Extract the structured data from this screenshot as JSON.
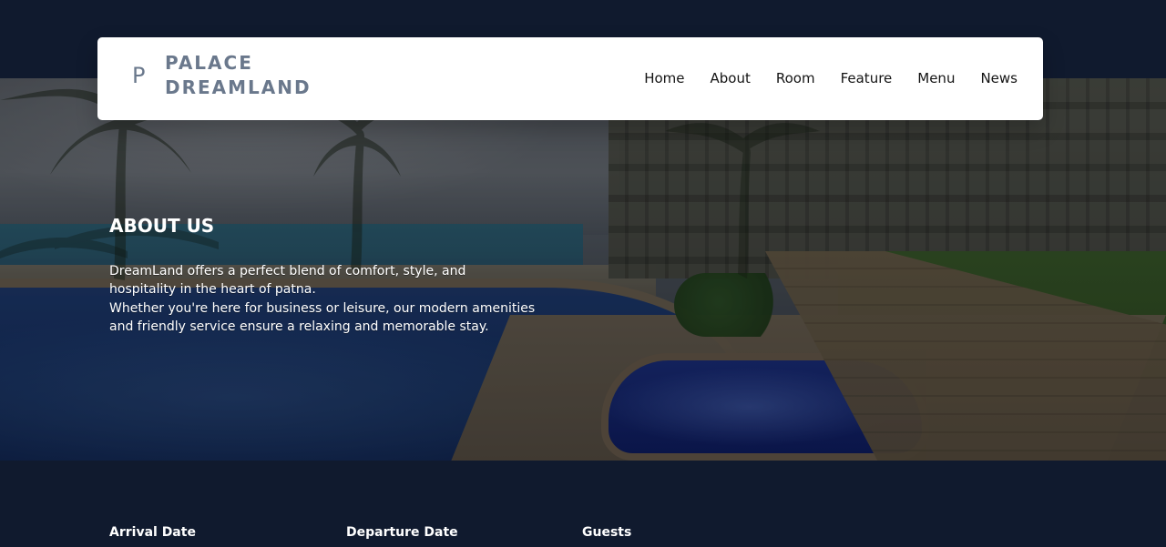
{
  "brand": {
    "mark": "P",
    "line1": "PALACE",
    "line2": "DREAMLAND"
  },
  "nav": {
    "items": [
      {
        "label": "Home"
      },
      {
        "label": "About"
      },
      {
        "label": "Room"
      },
      {
        "label": "Feature"
      },
      {
        "label": "Menu"
      },
      {
        "label": "News"
      }
    ]
  },
  "hero": {
    "title": "ABOUT US",
    "lines": [
      "DreamLand offers a perfect blend of comfort, style, and",
      "hospitality in the heart of patna.",
      "Whether you're here for business or leisure, our modern amenities",
      "and friendly service ensure a relaxing and memorable stay."
    ]
  },
  "booking": {
    "arrival_label": "Arrival Date",
    "departure_label": "Departure Date",
    "guests_label": "Guests"
  },
  "colors": {
    "page_bg": "#101a2e",
    "brand_gray": "#6a788c",
    "cta": "#f2b72b"
  }
}
